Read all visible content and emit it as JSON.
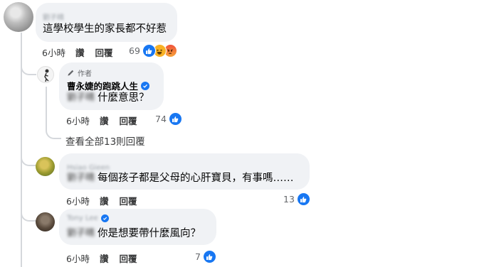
{
  "comments": [
    {
      "author": "劉子晴",
      "text": "這學校學生的家長都不好惹",
      "time": "6小時",
      "like_label": "讚",
      "reply_label": "回覆",
      "reaction_count": "69",
      "reactions": [
        "like",
        "haha",
        "angry"
      ]
    },
    {
      "badge": "作者",
      "author": "曹永婕的跑跳人生",
      "verified": true,
      "mention": "劉子晴",
      "text": "什麼意思？",
      "time": "6小時",
      "like_label": "讚",
      "reply_label": "回覆",
      "reaction_count": "74",
      "reactions": [
        "like"
      ]
    },
    {
      "author": "Hsiao Gieen",
      "mention": "劉子晴",
      "text": "每個孩子都是父母的心肝寶貝，有事嗎……",
      "time": "6小時",
      "like_label": "讚",
      "reply_label": "回覆",
      "reaction_count": "13",
      "reactions": [
        "like"
      ]
    },
    {
      "author": "Tony Lee",
      "verified": true,
      "mention": "劉子晴",
      "text": "你是想要帶什麼風向？",
      "time": "6小時",
      "like_label": "讚",
      "reply_label": "回覆",
      "reaction_count": "7",
      "reactions": [
        "like"
      ]
    }
  ],
  "view_replies": "查看全部13則回覆",
  "colors": {
    "like_blue": "#1877f2",
    "bubble": "#f0f2f5",
    "thread_line": "#d5d8dc"
  }
}
